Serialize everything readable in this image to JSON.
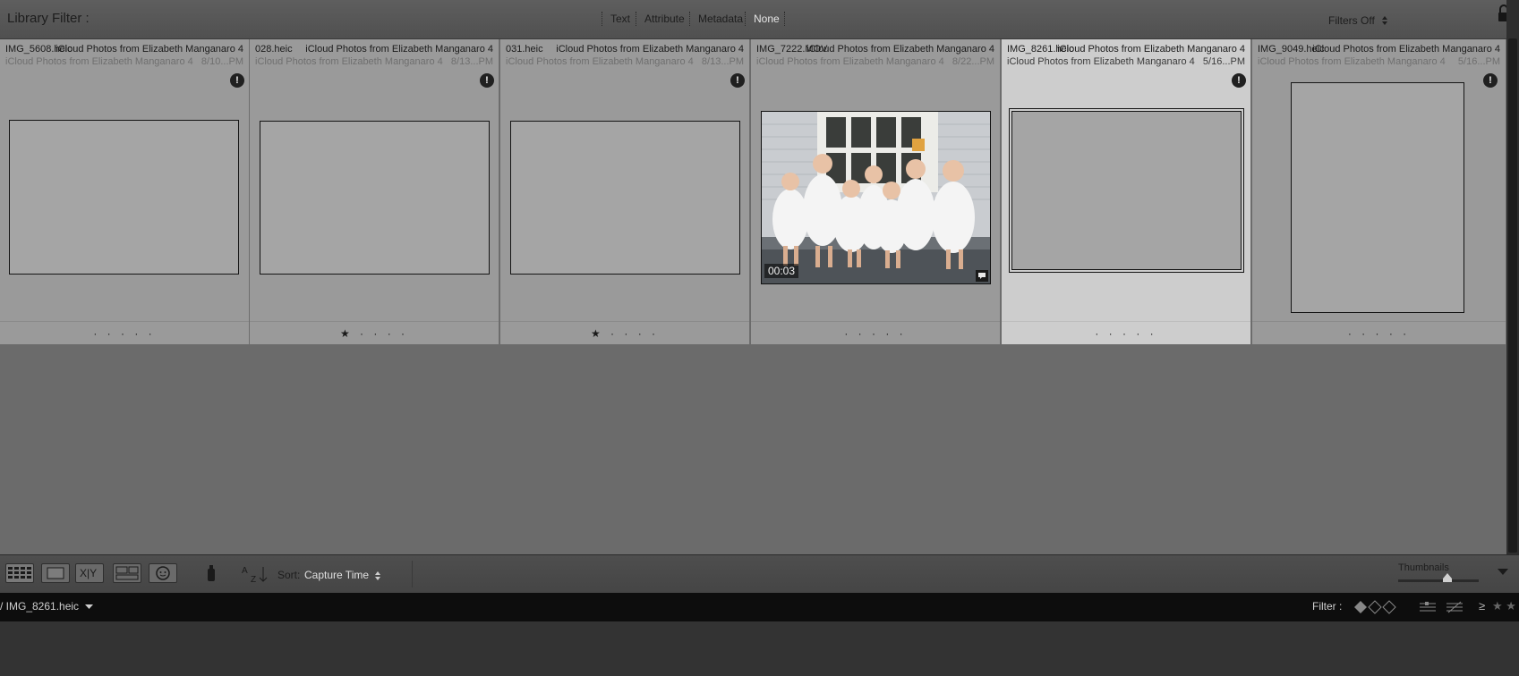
{
  "filter_bar": {
    "title": "Library Filter :",
    "tabs": [
      {
        "label": "Text",
        "active": false
      },
      {
        "label": "Attribute",
        "active": false
      },
      {
        "label": "Metadata",
        "active": false
      },
      {
        "label": "None",
        "active": true
      }
    ],
    "filters_state": "Filters Off",
    "filters_state_icon": "updown-arrow-icon",
    "lock_icon": "lock-icon"
  },
  "cells": [
    {
      "filename": "IMG_5608.heic",
      "album": "iCloud Photos from Elizabeth Manganaro 4",
      "subtitle": "iCloud Photos from Elizabeth Manganaro 4",
      "date": "8/10...PM",
      "warning": "!",
      "rating": "· · · · ·",
      "rated_stars": 0,
      "selected": false,
      "thumb_kind": "blank"
    },
    {
      "filename": "028.heic",
      "album": "iCloud Photos from Elizabeth Manganaro 4",
      "subtitle": "iCloud Photos from Elizabeth Manganaro 4",
      "date": "8/13...PM",
      "warning": "!",
      "rating": "★ · · · ·",
      "rated_stars": 1,
      "selected": false,
      "thumb_kind": "blank"
    },
    {
      "filename": "031.heic",
      "album": "iCloud Photos from Elizabeth Manganaro 4",
      "subtitle": "iCloud Photos from Elizabeth Manganaro 4",
      "date": "8/13...PM",
      "warning": "!",
      "rating": "★ · · · ·",
      "rated_stars": 1,
      "selected": false,
      "thumb_kind": "blank"
    },
    {
      "filename": "IMG_7222.MOV",
      "album": "iCloud Photos from Elizabeth Manganaro 4",
      "subtitle": "iCloud Photos from Elizabeth Manganaro 4",
      "date": "8/22...PM",
      "warning": "",
      "rating": "· · · · ·",
      "rated_stars": 0,
      "selected": false,
      "thumb_kind": "video",
      "duration": "00:03",
      "comment_icon": "speech-bubble-icon"
    },
    {
      "filename": "IMG_8261.heic",
      "album": "iCloud Photos from Elizabeth Manganaro 4",
      "subtitle": "iCloud Photos from Elizabeth Manganaro 4",
      "date": "5/16...PM",
      "warning": "!",
      "rating": "· · · · ·",
      "rated_stars": 0,
      "selected": true,
      "thumb_kind": "blank"
    },
    {
      "filename": "IMG_9049.heic",
      "album": "iCloud Photos from Elizabeth Manganaro 4",
      "subtitle": "iCloud Photos from Elizabeth Manganaro 4",
      "date": "5/16...PM",
      "warning": "!",
      "rating": "· · · · ·",
      "rated_stars": 0,
      "selected": false,
      "thumb_kind": "portrait"
    }
  ],
  "toolbar": {
    "view_icons": [
      "grid-view-icon",
      "loupe-view-icon",
      "compare-view-icon",
      "survey-view-icon",
      "people-view-icon"
    ],
    "compare_label": "X|Y",
    "spray_icon": "painter-spray-can-icon",
    "sort_direction_icon": "sort-az-icon",
    "sort_label": "Sort:",
    "sort_value": "Capture Time",
    "thumbnails_label": "Thumbnails",
    "menu_icon": "triangle-down-icon"
  },
  "filmstrip": {
    "breadcrumb": "/ IMG_8261.heic",
    "filter_label": "Filter :",
    "filter_icons": [
      "flag-filter-icon",
      "pick-filter-icon",
      "reject-filter-icon",
      "color-label-filter-icon",
      "custom-filter-icon"
    ],
    "rating_op": "≥",
    "stars": "★ ★"
  },
  "colors": {
    "panel_bg": "#9a9a9a",
    "selected_bg": "#cdcdcd",
    "grid_bg": "#6b6b6b",
    "active_tab": "#e6e6e6"
  }
}
